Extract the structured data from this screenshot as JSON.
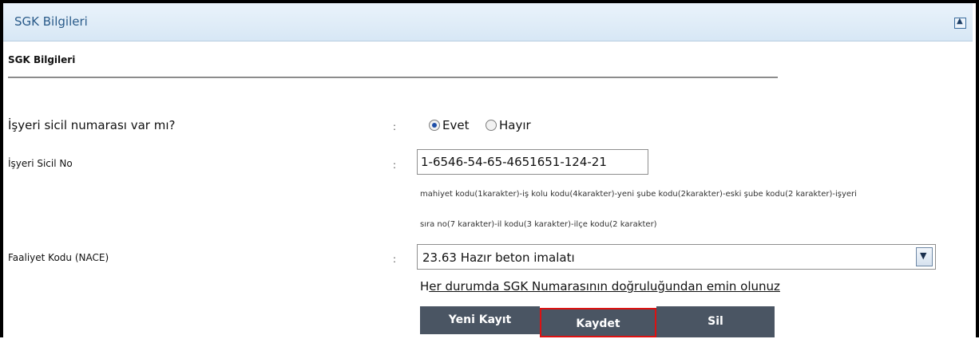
{
  "header": {
    "title": "SGK Bilgileri",
    "collapse_icon": "chevron-up-icon"
  },
  "section": {
    "title": "SGK Bilgileri"
  },
  "fields": {
    "sicil_question": {
      "label": "İşyeri sicil numarası var mı?",
      "colon": ":",
      "options": [
        {
          "label": "Evet",
          "checked": true
        },
        {
          "label": "Hayır",
          "checked": false
        }
      ]
    },
    "sicil_no": {
      "label": "İşyeri Sicil No",
      "colon": ":",
      "value": "1-6546-54-65-4651651-124-21",
      "help_line1": "mahiyet kodu(1karakter)-iş kolu kodu(4karakter)-yeni şube kodu(2karakter)-eski şube kodu(2 karakter)-işyeri",
      "help_line2": "sıra no(7 karakter)-il kodu(3 karakter)-ilçe kodu(2 karakter)"
    },
    "faaliyet": {
      "label": "Faaliyet Kodu (NACE)",
      "colon": ":",
      "selected": "23.63   Hazır beton imalatı"
    }
  },
  "warning": {
    "first_letter": "H",
    "rest": "er durumda SGK Numarasının doğruluğundan emin olunuz"
  },
  "buttons": {
    "new": "Yeni Kayıt",
    "save": "Kaydet",
    "delete": "Sil"
  }
}
